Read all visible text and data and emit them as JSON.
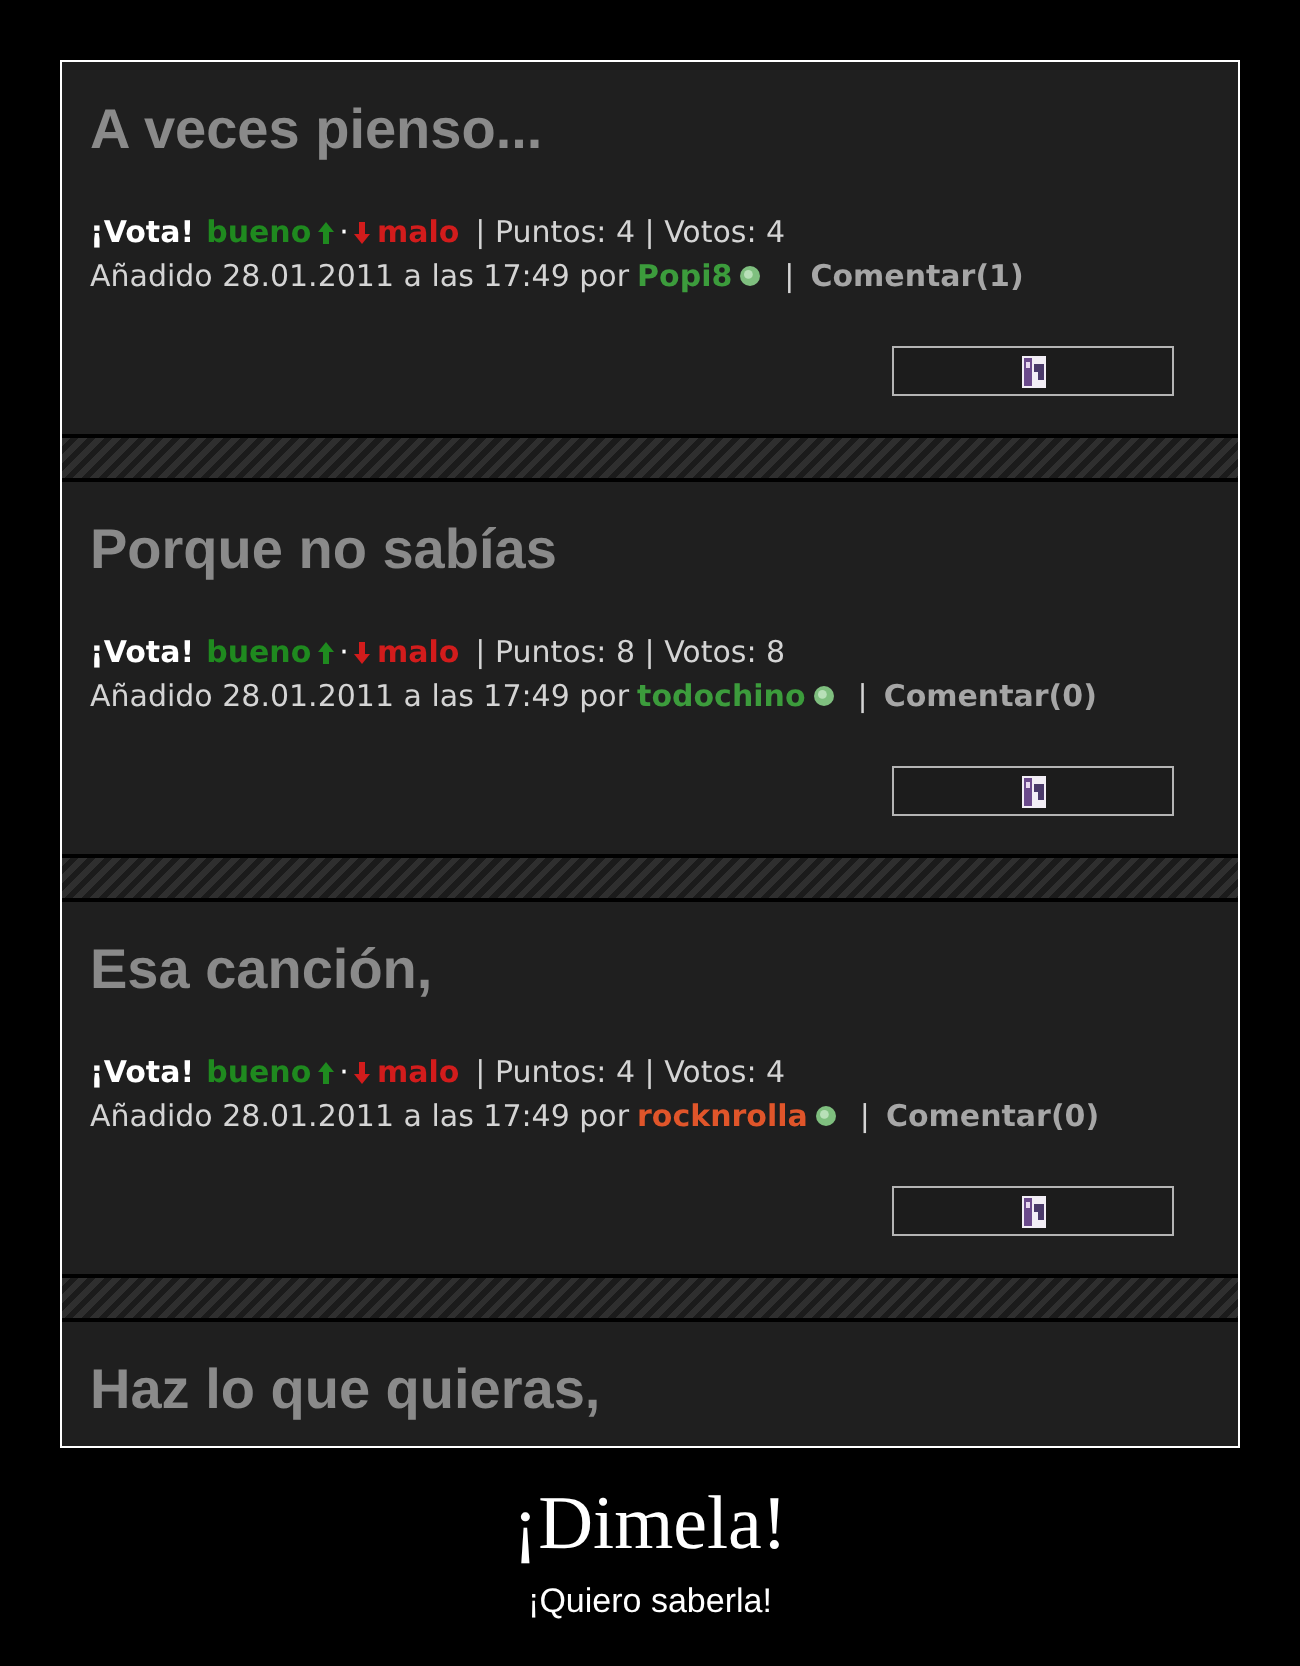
{
  "posts": [
    {
      "title": "A veces pienso...",
      "vote": {
        "label": "¡Vota!",
        "up": "bueno",
        "dot": "·",
        "down": "malo",
        "stats": "| Puntos: 4 | Votos: 4"
      },
      "added": {
        "text": "Añadido 28.01.2011 a las 17:49 por",
        "author": {
          "name": "Popi8",
          "color": "#3c9c3c"
        },
        "divider": "|",
        "comments": "Comentar(1)"
      }
    },
    {
      "title": "Porque no sabías",
      "vote": {
        "label": "¡Vota!",
        "up": "bueno",
        "dot": "·",
        "down": "malo",
        "stats": "| Puntos: 8 | Votos: 8"
      },
      "added": {
        "text": "Añadido 28.01.2011 a las 17:49 por",
        "author": {
          "name": "todochino",
          "color": "#3c9c3c"
        },
        "divider": "|",
        "comments": "Comentar(0)"
      }
    },
    {
      "title": "Esa canción,",
      "vote": {
        "label": "¡Vota!",
        "up": "bueno",
        "dot": "·",
        "down": "malo",
        "stats": "| Puntos: 4 | Votos: 4"
      },
      "added": {
        "text": "Añadido 28.01.2011 a las 17:49 por",
        "author": {
          "name": "rocknrolla",
          "color": "#e0552a"
        },
        "divider": "|",
        "comments": "Comentar(0)"
      }
    },
    {
      "title": "Haz lo que quieras,"
    }
  ],
  "caption": {
    "title": "¡Dimela!",
    "subtitle": "¡Quiero saberla!"
  }
}
